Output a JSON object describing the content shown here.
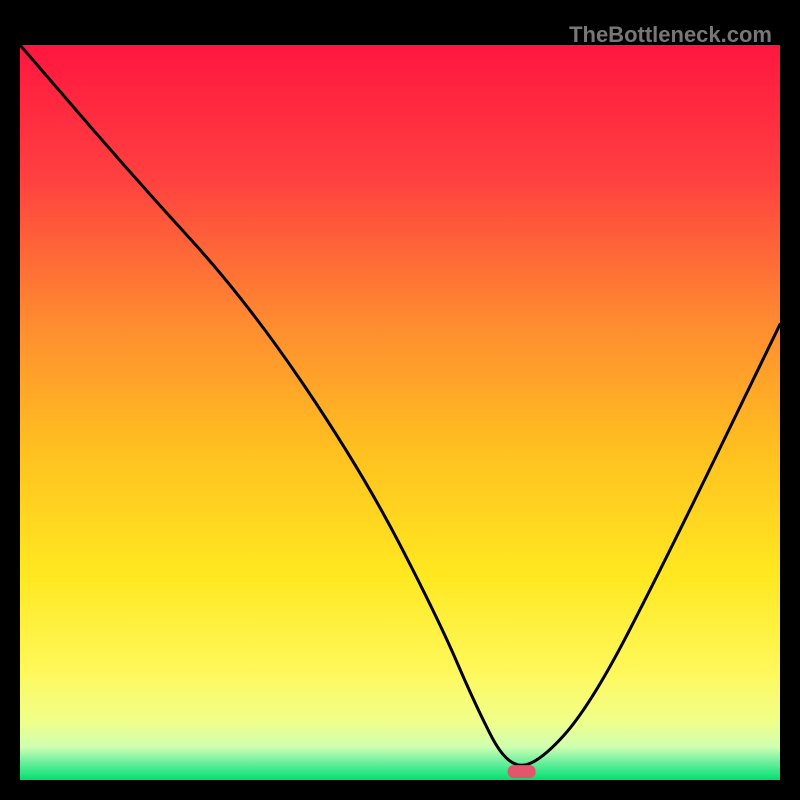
{
  "watermark": "TheBottleneck.com",
  "chart_data": {
    "type": "line",
    "title": "",
    "xlabel": "",
    "ylabel": "",
    "xlim": [
      0,
      100
    ],
    "ylim": [
      0,
      100
    ],
    "x": [
      0,
      15,
      30,
      45,
      55,
      60,
      64,
      68,
      75,
      85,
      100
    ],
    "values": [
      100,
      82,
      65,
      42,
      22,
      10,
      2,
      2,
      10,
      30,
      62
    ],
    "marker": {
      "x": 66,
      "y": 1.2
    },
    "gradient_stops": [
      {
        "offset": 0.0,
        "color": "#ff163f"
      },
      {
        "offset": 0.18,
        "color": "#ff4040"
      },
      {
        "offset": 0.38,
        "color": "#ff8c30"
      },
      {
        "offset": 0.55,
        "color": "#ffc020"
      },
      {
        "offset": 0.72,
        "color": "#ffe820"
      },
      {
        "offset": 0.85,
        "color": "#fff85a"
      },
      {
        "offset": 0.92,
        "color": "#f0ff8a"
      },
      {
        "offset": 0.955,
        "color": "#cfffb0"
      },
      {
        "offset": 0.975,
        "color": "#70f0a0"
      },
      {
        "offset": 1.0,
        "color": "#00e070"
      }
    ]
  }
}
